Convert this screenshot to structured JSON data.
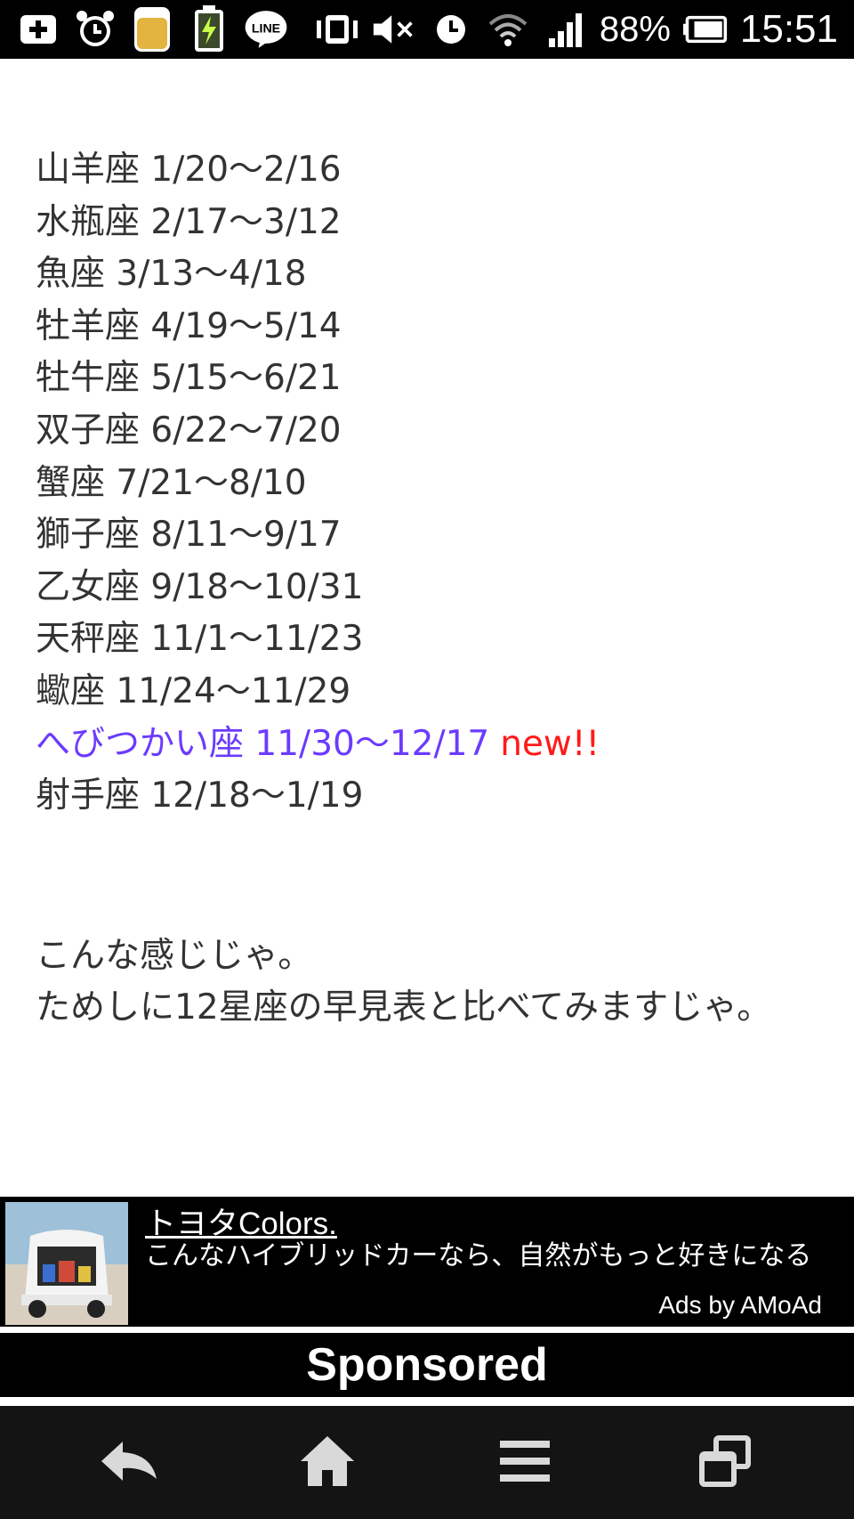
{
  "status_bar": {
    "battery_percent": "88%",
    "time": "15:51",
    "line_icon_label": "LINE"
  },
  "constellations": [
    {
      "name": "山羊座",
      "range": "1/20〜2/16"
    },
    {
      "name": "水瓶座",
      "range": "2/17〜3/12"
    },
    {
      "name": "魚座",
      "range": "3/13〜4/18"
    },
    {
      "name": "牡羊座",
      "range": "4/19〜5/14"
    },
    {
      "name": "牡牛座",
      "range": "5/15〜6/21"
    },
    {
      "name": "双子座",
      "range": "6/22〜7/20"
    },
    {
      "name": "蟹座",
      "range": "7/21〜8/10"
    },
    {
      "name": "獅子座",
      "range": "8/11〜9/17"
    },
    {
      "name": "乙女座",
      "range": "9/18〜10/31"
    },
    {
      "name": "天秤座",
      "range": "11/1〜11/23"
    },
    {
      "name": "蠍座",
      "range": "11/24〜11/29"
    },
    {
      "name": "へびつかい座",
      "range": "11/30〜12/17",
      "badge": "new!!"
    },
    {
      "name": "射手座",
      "range": "12/18〜1/19"
    }
  ],
  "paragraph": {
    "line1": "こんな感じじゃ。",
    "line2": "ためしに12星座の早見表と比べてみますじゃ。"
  },
  "ad": {
    "title": "トヨタColors.",
    "description": "こんなハイブリッドカーなら、自然がもっと好きになる",
    "attribution": "Ads by AMoAd"
  },
  "sponsored_label": "Sponsored",
  "colors": {
    "highlight": "#6b3bff",
    "badge": "#ff1a1a",
    "text": "#333333"
  },
  "icons": {
    "status_left": [
      "add-box-icon",
      "alarm-icon",
      "cup-icon",
      "battery-charging-icon",
      "line-app-icon"
    ],
    "status_right": [
      "vibrate-icon",
      "mute-icon",
      "clock-icon",
      "wifi-icon",
      "signal-icon",
      "battery-icon"
    ],
    "nav": [
      "back-icon",
      "home-icon",
      "menu-icon",
      "recent-apps-icon"
    ]
  }
}
